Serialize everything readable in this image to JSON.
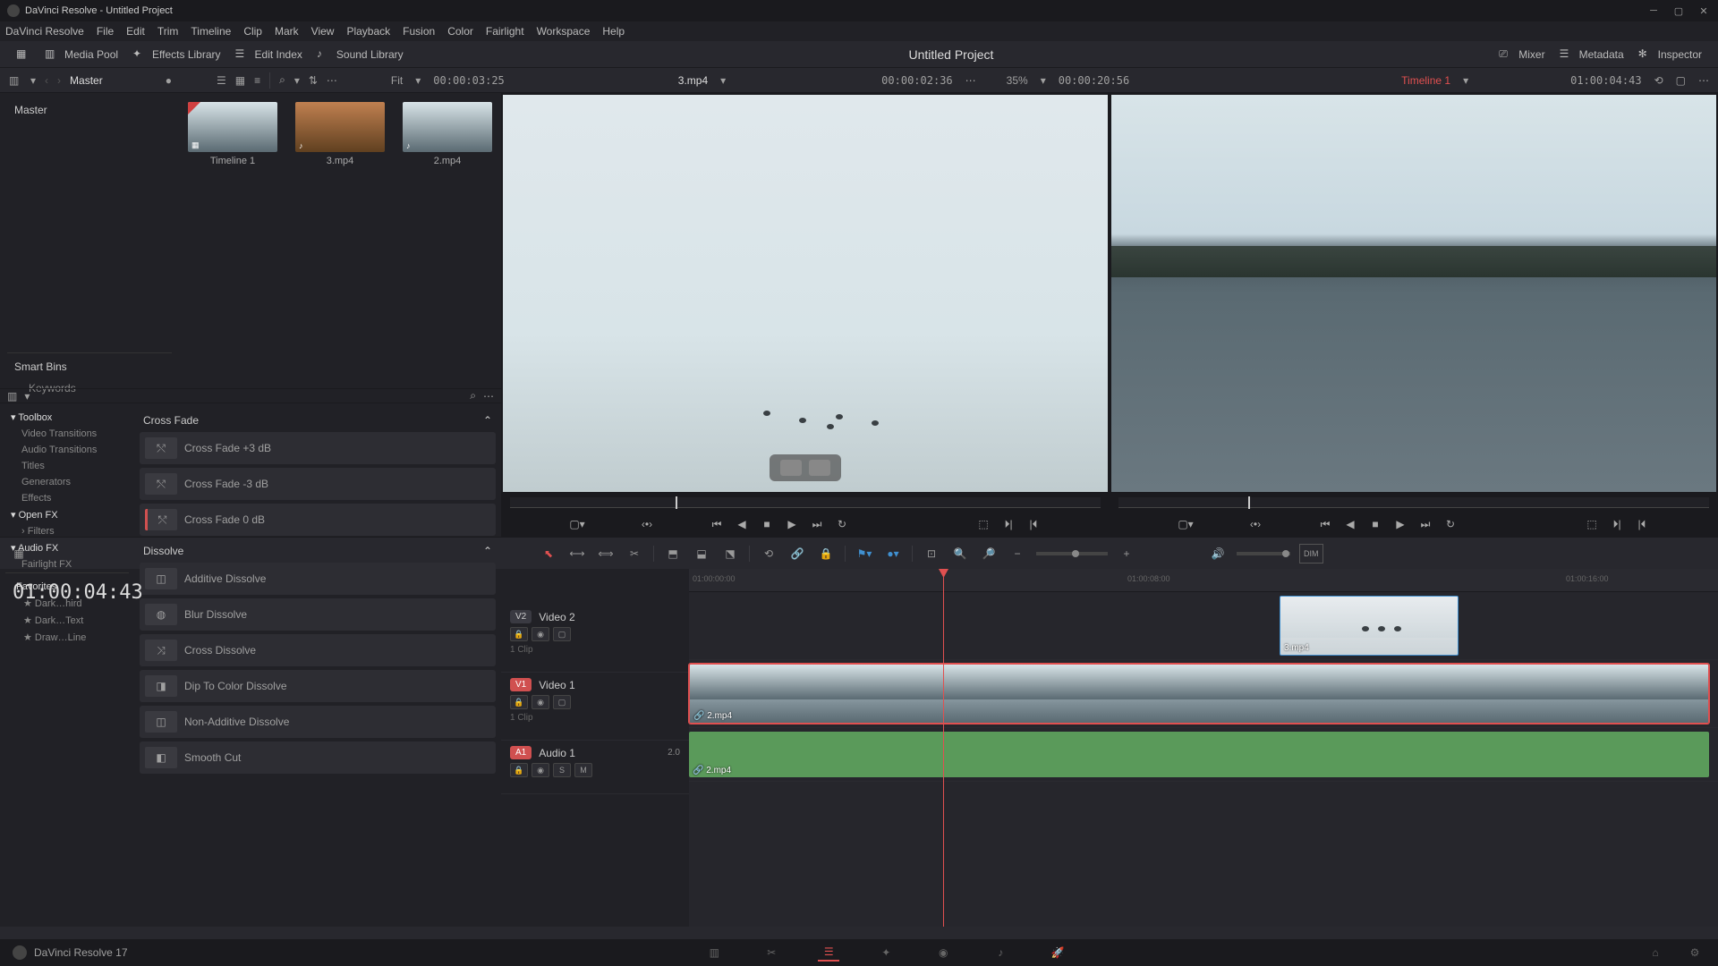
{
  "app": {
    "title": "DaVinci Resolve - Untitled Project",
    "name": "DaVinci Resolve",
    "version": "DaVinci Resolve 17"
  },
  "menu": [
    "DaVinci Resolve",
    "File",
    "Edit",
    "Trim",
    "Timeline",
    "Clip",
    "Mark",
    "View",
    "Playback",
    "Fusion",
    "Color",
    "Fairlight",
    "Workspace",
    "Help"
  ],
  "toolbar": {
    "media_pool": "Media Pool",
    "effects_library": "Effects Library",
    "edit_index": "Edit Index",
    "sound_library": "Sound Library",
    "mixer": "Mixer",
    "metadata": "Metadata",
    "inspector": "Inspector",
    "project_title": "Untitled Project"
  },
  "secondary": {
    "master": "Master",
    "fit": "Fit",
    "source_tc": "00:00:03:25",
    "source_name": "3.mp4",
    "source_pos": "00:00:02:36",
    "zoom_pct": "35%",
    "program_tc": "00:00:20:56",
    "timeline_name": "Timeline 1",
    "program_pos": "01:00:04:43"
  },
  "bins": {
    "master": "Master",
    "smart_bins": "Smart Bins",
    "keywords": "Keywords"
  },
  "clips": [
    {
      "name": "Timeline 1"
    },
    {
      "name": "3.mp4"
    },
    {
      "name": "2.mp4"
    }
  ],
  "fx_tree": {
    "toolbox": "Toolbox",
    "items": [
      "Video Transitions",
      "Audio Transitions",
      "Titles",
      "Generators",
      "Effects"
    ],
    "open_fx": "Open FX",
    "filters": "Filters",
    "audio_fx": "Audio FX",
    "fairlight_fx": "Fairlight FX",
    "favorites": "Favorites",
    "fav_items": [
      "Dark…hird",
      "Dark…Text",
      "Draw…Line"
    ]
  },
  "fx_groups": [
    {
      "title": "Cross Fade",
      "items": [
        "Cross Fade +3 dB",
        "Cross Fade -3 dB",
        "Cross Fade 0 dB"
      ]
    },
    {
      "title": "Dissolve",
      "items": [
        "Additive Dissolve",
        "Blur Dissolve",
        "Cross Dissolve",
        "Dip To Color Dissolve",
        "Non-Additive Dissolve",
        "Smooth Cut"
      ]
    }
  ],
  "timeline": {
    "big_tc": "01:00:04:43",
    "ruler": [
      "01:00:00:00",
      "01:00:08:00",
      "01:00:16:00"
    ],
    "tracks": {
      "v2": {
        "badge": "V2",
        "name": "Video 2",
        "clip_count": "1 Clip"
      },
      "v1": {
        "badge": "V1",
        "name": "Video 1",
        "clip_count": "1 Clip"
      },
      "a1": {
        "badge": "A1",
        "name": "Audio 1",
        "ch": "2.0"
      }
    },
    "clips": {
      "v2_clip": "3.mp4",
      "v1_clip": "2.mp4",
      "a1_clip": "2.mp4"
    },
    "track_btns": {
      "s": "S",
      "m": "M"
    }
  }
}
